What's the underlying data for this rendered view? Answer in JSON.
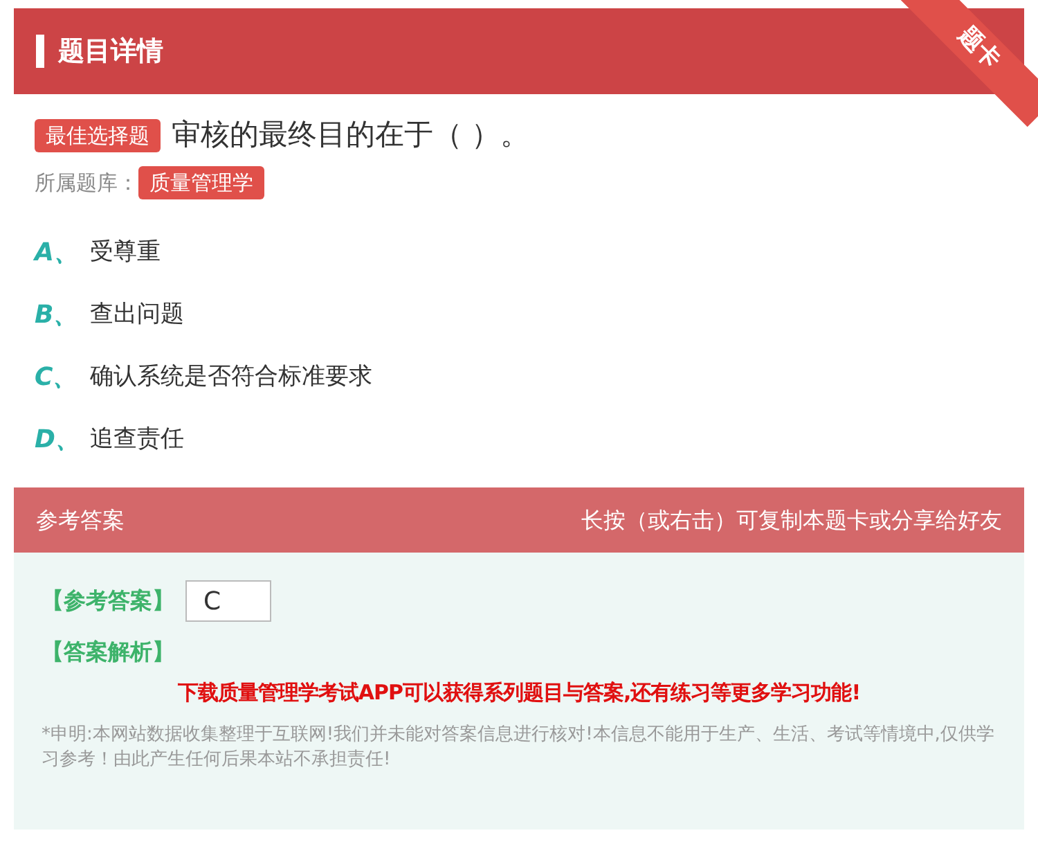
{
  "header": {
    "title": "题目详情",
    "ribbon": "题卡"
  },
  "question": {
    "type_badge": "最佳选择题",
    "text": "审核的最终目的在于（ ）。",
    "bank_label": "所属题库：",
    "bank": "质量管理学"
  },
  "options": [
    {
      "letter": "A、",
      "text": "受尊重"
    },
    {
      "letter": "B、",
      "text": "查出问题"
    },
    {
      "letter": "C、",
      "text": "确认系统是否符合标准要求"
    },
    {
      "letter": "D、",
      "text": "追查责任"
    }
  ],
  "answer_bar": {
    "title": "参考答案",
    "hint": "长按（或右击）可复制本题卡或分享给好友"
  },
  "answer": {
    "label": "【参考答案】",
    "value": "C",
    "analysis_label": "【答案解析】",
    "promo": "下载质量管理学考试APP可以获得系列题目与答案,还有练习等更多学习功能!",
    "disclaimer": "*申明:本网站数据收集整理于互联网!我们并未能对答案信息进行核对!本信息不能用于生产、生活、考试等情境中,仅供学习参考！由此产生任何后果本站不承担责任!"
  }
}
